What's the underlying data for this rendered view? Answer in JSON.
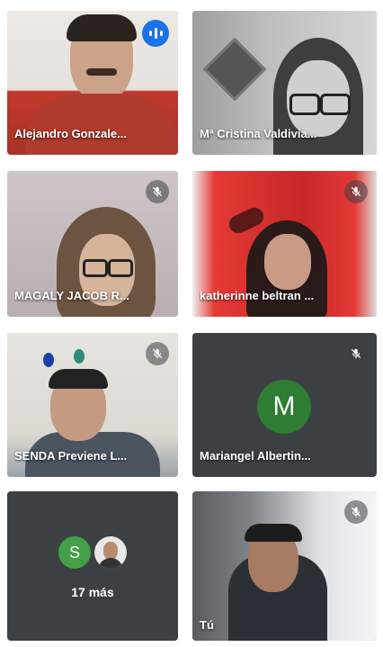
{
  "participants": [
    {
      "name": "Alejandro Gonzale...",
      "state": "speaking"
    },
    {
      "name": "Mª Cristina Valdivia...",
      "state": "video"
    },
    {
      "name": "MAGALY JACOB R...",
      "state": "muted"
    },
    {
      "name": "katherinne beltran ...",
      "state": "muted"
    },
    {
      "name": "SENDA Previene L...",
      "state": "muted"
    },
    {
      "name": "Mariangel Albertin...",
      "state": "muted",
      "initial": "M",
      "avatar_color": "#2e7d32"
    },
    {
      "overflow_label": "17 más",
      "avatar_initial": "S",
      "avatar_color": "#43a047"
    },
    {
      "name": "Tú",
      "state": "muted"
    }
  ],
  "colors": {
    "active_border": "#8ab4f8",
    "speaking_badge": "#1a73e8",
    "tile_bg": "#3c4043"
  }
}
